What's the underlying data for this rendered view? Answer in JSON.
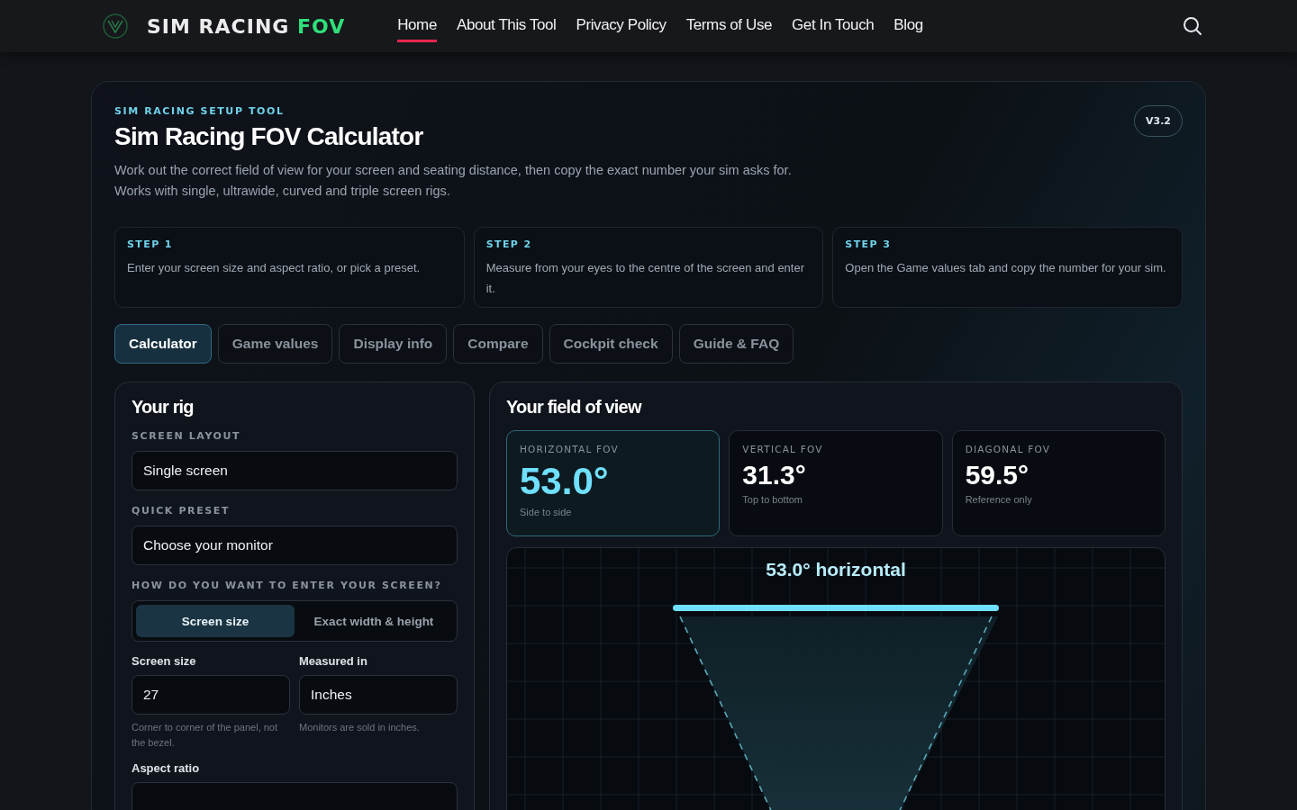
{
  "header": {
    "brand": "SIM RACING",
    "brand_accent": "FOV",
    "nav": [
      {
        "label": "Home",
        "selected": true
      },
      {
        "label": "About This Tool",
        "selected": false
      },
      {
        "label": "Privacy Policy",
        "selected": false
      },
      {
        "label": "Terms of Use",
        "selected": false
      },
      {
        "label": "Get In Touch",
        "selected": false
      },
      {
        "label": "Blog",
        "selected": false
      }
    ]
  },
  "hero": {
    "eyebrow": "SIM RACING SETUP TOOL",
    "title": "Sim Racing FOV Calculator",
    "version": "V3.2",
    "description": "Work out the correct field of view for your screen and seating distance, then copy the exact number your sim asks for. Works with single, ultrawide, curved and triple screen rigs."
  },
  "steps": [
    {
      "label": "STEP 1",
      "text": "Enter your screen size and aspect ratio, or pick a preset."
    },
    {
      "label": "STEP 2",
      "text": "Measure from your eyes to the centre of the screen and enter it."
    },
    {
      "label": "STEP 3",
      "text": "Open the Game values tab and copy the number for your sim."
    }
  ],
  "tabs": [
    {
      "label": "Calculator",
      "selected": true
    },
    {
      "label": "Game values",
      "selected": false
    },
    {
      "label": "Display info",
      "selected": false
    },
    {
      "label": "Compare",
      "selected": false
    },
    {
      "label": "Cockpit check",
      "selected": false
    },
    {
      "label": "Guide & FAQ",
      "selected": false
    }
  ],
  "rig": {
    "title": "Your rig",
    "layout_label": "SCREEN LAYOUT",
    "layout_value": "Single screen",
    "preset_label": "QUICK PRESET",
    "preset_value": "Choose your monitor",
    "entry_label": "HOW DO YOU WANT TO ENTER YOUR SCREEN?",
    "entry_options": [
      {
        "label": "Screen size",
        "selected": true
      },
      {
        "label": "Exact width & height",
        "selected": false
      }
    ],
    "fields": [
      {
        "label": "Screen size",
        "value": "27",
        "hint": "Corner to corner of the panel, not the bezel."
      },
      {
        "label": "Measured in",
        "value": "Inches",
        "hint": "Monitors are sold in inches."
      }
    ],
    "aspect_label": "Aspect ratio"
  },
  "fov": {
    "title": "Your field of view",
    "cards": [
      {
        "label": "HORIZONTAL FOV",
        "value": "53.0°",
        "note": "Side to side",
        "selected": true
      },
      {
        "label": "VERTICAL FOV",
        "value": "31.3°",
        "note": "Top to bottom",
        "selected": false
      },
      {
        "label": "DIAGONAL FOV",
        "value": "59.5°",
        "note": "Reference only",
        "selected": false
      }
    ],
    "diagram_label": "53.0° horizontal"
  }
}
